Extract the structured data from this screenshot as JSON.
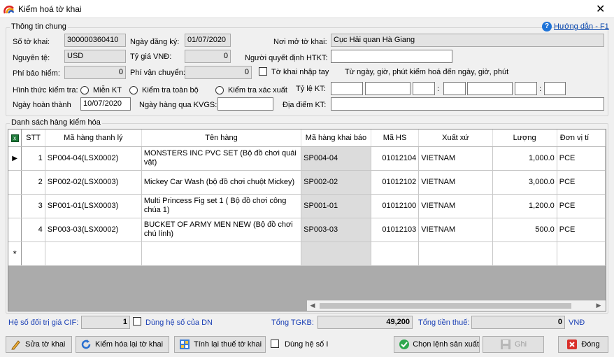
{
  "window": {
    "title": "Kiểm hoá tờ khai",
    "close_glyph": "✕"
  },
  "general": {
    "section_title": "Thông tin chung",
    "help_link": "Hướng dẫn - F1",
    "so_to_khai_label": "Số tờ khai:",
    "so_to_khai": "300000360410",
    "ngay_dang_ky_label": "Ngày đăng ký:",
    "ngay_dang_ky": "01/07/2020",
    "noi_mo_label": "Nơi mở tờ khai:",
    "noi_mo": "Cục Hải quan Hà Giang",
    "nguyen_te_label": "Nguyên tệ:",
    "nguyen_te": "USD",
    "ty_gia_label": "Tỷ giá VNĐ:",
    "ty_gia": "0",
    "nguoi_quyet_dinh_label": "Người quyết định HTKT:",
    "nguoi_quyet_dinh": "",
    "phi_bao_hiem_label": "Phí bảo hiểm:",
    "phi_bao_hiem": "0",
    "phi_van_chuyen_label": "Phí vận chuyển:",
    "phi_van_chuyen": "0",
    "to_khai_nhap_tay_label": "Tờ khai nhập tay",
    "tu_ngay_note": "Từ ngày, giờ, phút kiểm hoá đến ngày, giờ, phút",
    "hinh_thuc_label": "Hình thức kiểm tra:",
    "mien_kt": "Miễn KT",
    "kiem_tra_toan_bo": "Kiểm tra toàn bộ",
    "kiem_tra_xac_xuat": "Kiểm tra xác xuất",
    "ty_le_label": "Tỷ lệ KT:",
    "ngay_hoan_thanh_label": "Ngày hoàn thành",
    "ngay_hoan_thanh": "10/07/2020",
    "ngay_hang_qua_label": "Ngày hàng qua KVGS:",
    "ngay_hang_qua": "",
    "dia_diem_label": "Địa điểm KT:",
    "dia_diem": ""
  },
  "goods": {
    "section_title": "Danh sách hàng kiểm hóa",
    "columns": [
      "STT",
      "Mã hàng thanh lý",
      "Tên hàng",
      "Mã hàng khai báo",
      "Mã HS",
      "Xuất xứ",
      "Lượng",
      "Đơn vị tí"
    ],
    "rows": [
      {
        "stt": "1",
        "ma_thanh_ly": "SP004-04(LSX0002)",
        "ten_hang": "MONSTERS INC PVC SET (Bộ đồ chơi quái vật)",
        "ma_khai_bao": "SP004-04",
        "ma_hs": "01012104",
        "xuat_xu": "VIETNAM",
        "luong": "1,000.0",
        "don_vi": "PCE"
      },
      {
        "stt": "2",
        "ma_thanh_ly": "SP002-02(LSX0003)",
        "ten_hang": "Mickey Car Wash (bộ đồ chơi chuột Mickey)",
        "ma_khai_bao": "SP002-02",
        "ma_hs": "01012102",
        "xuat_xu": "VIETNAM",
        "luong": "3,000.0",
        "don_vi": "PCE"
      },
      {
        "stt": "3",
        "ma_thanh_ly": "SP001-01(LSX0003)",
        "ten_hang": "Multi Princess Fig set 1 ( Bộ đồ chơi công chúa 1)",
        "ma_khai_bao": "SP001-01",
        "ma_hs": "01012100",
        "xuat_xu": "VIETNAM",
        "luong": "1,200.0",
        "don_vi": "PCE"
      },
      {
        "stt": "4",
        "ma_thanh_ly": "SP003-03(LSX0002)",
        "ten_hang": "BUCKET OF ARMY MEN NEW (Bộ đồ chơi chú lính)",
        "ma_khai_bao": "SP003-03",
        "ma_hs": "01012103",
        "xuat_xu": "VIETNAM",
        "luong": "500.0",
        "don_vi": "PCE"
      }
    ],
    "current_row_glyph": "▶",
    "new_row_glyph": "*"
  },
  "summary": {
    "he_so_label": "Hệ số đối trị giá CIF:",
    "he_so": "1",
    "dung_he_so_dn": "Dùng hệ số của DN",
    "tong_tgkb_label": "Tổng TGKB:",
    "tong_tgkb": "49,200",
    "tong_tien_thue_label": "Tổng tiền thuế:",
    "tong_tien_thue": "0",
    "currency": "VNĐ"
  },
  "buttons": {
    "sua": "Sửa tờ khai",
    "kiem_hoa_lai": "Kiểm hóa lại tờ khai",
    "tinh_lai": "Tính lại thuế tờ khai",
    "dung_he_so_i": "Dùng hệ số I",
    "chon_lenh": "Chọn lệnh sản xuất",
    "ghi": "Ghi",
    "dong": "Đóng"
  },
  "colors": {
    "link": "#0645ad",
    "label_blue": "#1a3fb5",
    "readonly": "#e3e3e3"
  }
}
